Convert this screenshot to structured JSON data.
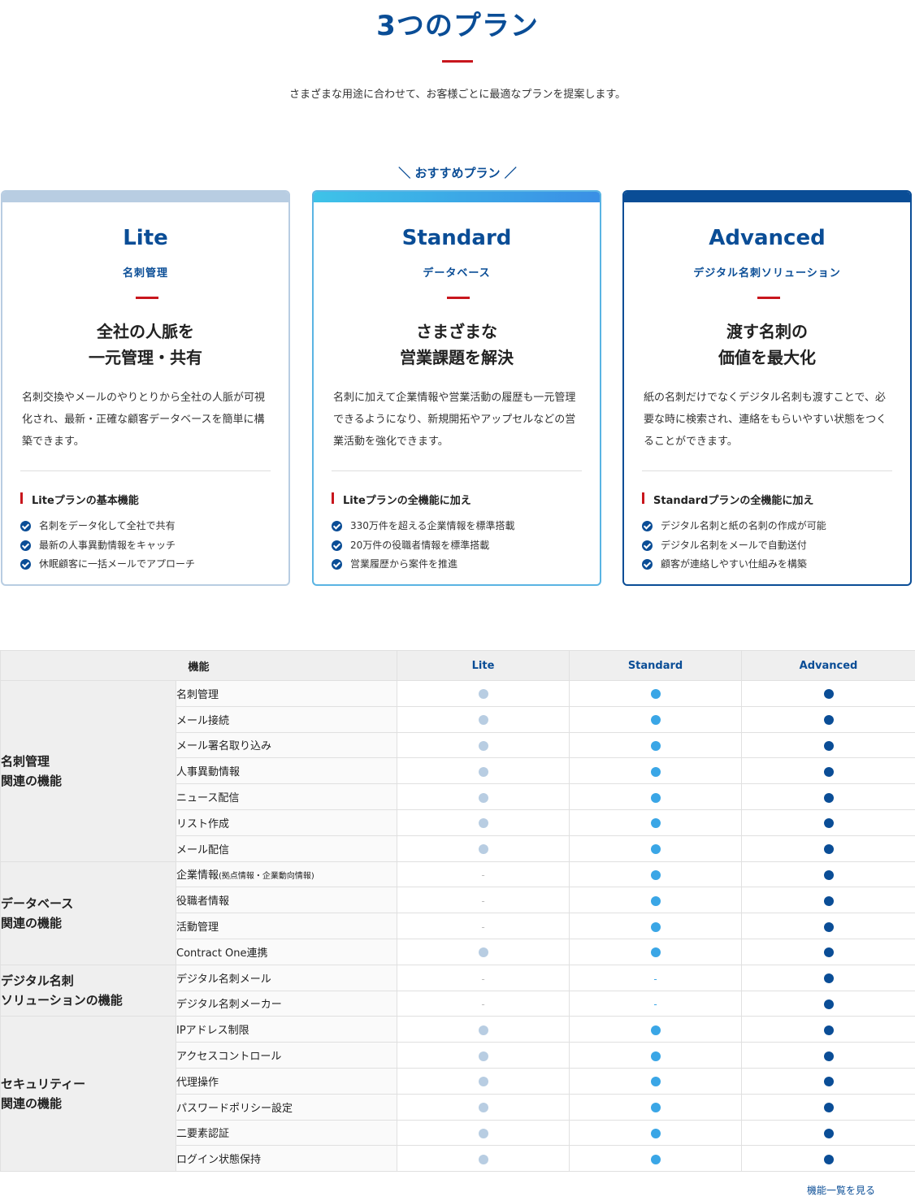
{
  "header": {
    "title": "3つのプラン",
    "subtitle": "さまざまな用途に合わせて、お客様ごとに最適なプランを提案します。",
    "recommend_label": "＼ おすすめプラン ／"
  },
  "colors": {
    "accent": "#c8161d",
    "brand": "#0a4d96",
    "lite": "#b8cde2",
    "standard": "#3aa6e6",
    "advanced": "#0a4d96"
  },
  "plans": [
    {
      "name": "Lite",
      "sub": "名刺管理",
      "headline1": "全社の人脈を",
      "headline2": "一元管理・共有",
      "desc": "名刺交換やメールのやりとりから全社の人脈が可視化され、最新・正確な顧客データベースを簡単に構築できます。",
      "feature_label": "Liteプランの基本機能",
      "features": [
        "名刺をデータ化して全社で共有",
        "最新の人事異動情報をキャッチ",
        "休眠顧客に一括メールでアプローチ"
      ]
    },
    {
      "name": "Standard",
      "sub": "データベース",
      "headline1": "さまざまな",
      "headline2": "営業課題を解決",
      "desc": "名刺に加えて企業情報や営業活動の履歴も一元管理できるようになり、新規開拓やアップセルなどの営業活動を強化できます。",
      "feature_label": "Liteプランの全機能に加え",
      "features": [
        "330万件を超える企業情報を標準搭載",
        "20万件の役職者情報を標準搭載",
        "営業履歴から案件を推進"
      ]
    },
    {
      "name": "Advanced",
      "sub": "デジタル名刺ソリューション",
      "headline1": "渡す名刺の",
      "headline2": "価値を最大化",
      "desc": "紙の名刺だけでなくデジタル名刺も渡すことで、必要な時に検索され、連絡をもらいやすい状態をつくることができます。",
      "feature_label": "Standardプランの全機能に加え",
      "features": [
        "デジタル名刺と紙の名刺の作成が可能",
        "デジタル名刺をメールで自動送付",
        "顧客が連絡しやすい仕組みを構築"
      ]
    }
  ],
  "table": {
    "headers": [
      "機能",
      "Lite",
      "Standard",
      "Advanced"
    ],
    "categories": [
      {
        "label1": "名刺管理",
        "label2": "関連の機能",
        "rows": [
          {
            "feature": "名刺管理",
            "lite": "dot",
            "standard": "dot",
            "advanced": "dot"
          },
          {
            "feature": "メール接続",
            "lite": "dot",
            "standard": "dot",
            "advanced": "dot"
          },
          {
            "feature": "メール署名取り込み",
            "lite": "dot",
            "standard": "dot",
            "advanced": "dot"
          },
          {
            "feature": "人事異動情報",
            "lite": "dot",
            "standard": "dot",
            "advanced": "dot"
          },
          {
            "feature": "ニュース配信",
            "lite": "dot",
            "standard": "dot",
            "advanced": "dot"
          },
          {
            "feature": "リスト作成",
            "lite": "dot",
            "standard": "dot",
            "advanced": "dot"
          },
          {
            "feature": "メール配信",
            "lite": "dot",
            "standard": "dot",
            "advanced": "dot"
          }
        ]
      },
      {
        "label1": "データベース",
        "label2": "関連の機能",
        "rows": [
          {
            "feature": "企業情報",
            "note": "(拠点情報・企業動向情報)",
            "lite": "-",
            "standard": "dot",
            "advanced": "dot"
          },
          {
            "feature": "役職者情報",
            "lite": "-",
            "standard": "dot",
            "advanced": "dot"
          },
          {
            "feature": "活動管理",
            "lite": "-",
            "standard": "dot",
            "advanced": "dot"
          },
          {
            "feature": "Contract One連携",
            "lite": "dot",
            "standard": "dot",
            "advanced": "dot"
          }
        ]
      },
      {
        "label1": "デジタル名刺",
        "label2": "ソリューションの機能",
        "rows": [
          {
            "feature": "デジタル名刺メール",
            "lite": "-",
            "standard": "-",
            "advanced": "dot"
          },
          {
            "feature": "デジタル名刺メーカー",
            "lite": "-",
            "standard": "-",
            "advanced": "dot"
          }
        ]
      },
      {
        "label1": "セキュリティー",
        "label2": "関連の機能",
        "rows": [
          {
            "feature": "IPアドレス制限",
            "lite": "dot",
            "standard": "dot",
            "advanced": "dot"
          },
          {
            "feature": "アクセスコントロール",
            "lite": "dot",
            "standard": "dot",
            "advanced": "dot"
          },
          {
            "feature": "代理操作",
            "lite": "dot",
            "standard": "dot",
            "advanced": "dot"
          },
          {
            "feature": "パスワードポリシー設定",
            "lite": "dot",
            "standard": "dot",
            "advanced": "dot"
          },
          {
            "feature": "二要素認証",
            "lite": "dot",
            "standard": "dot",
            "advanced": "dot"
          },
          {
            "feature": "ログイン状態保持",
            "lite": "dot",
            "standard": "dot",
            "advanced": "dot"
          }
        ]
      }
    ]
  },
  "more_link": "機能一覧を見る"
}
